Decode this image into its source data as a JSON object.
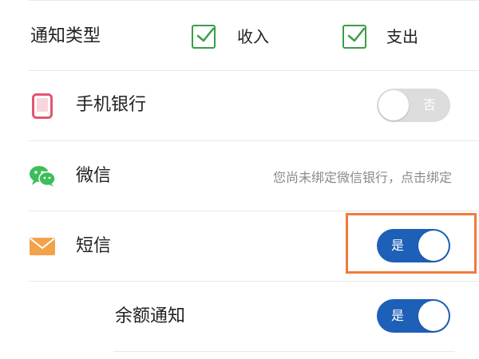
{
  "notify_type": {
    "label": "通知类型",
    "options": [
      {
        "label": "收入",
        "checked": true
      },
      {
        "label": "支出",
        "checked": true
      }
    ]
  },
  "mobile_banking": {
    "label": "手机银行",
    "icon": "phone-icon",
    "toggle_state": "off",
    "toggle_text": "否"
  },
  "wechat": {
    "label": "微信",
    "icon": "wechat-icon",
    "hint": "您尚未绑定微信银行，点击绑定"
  },
  "sms": {
    "label": "短信",
    "icon": "mail-icon",
    "toggle_state": "on",
    "toggle_text": "是"
  },
  "balance_notice": {
    "label": "余额通知",
    "toggle_state": "on",
    "toggle_text": "是"
  },
  "colors": {
    "toggle_on": "#1e5fb7",
    "toggle_off": "#dcdcdc",
    "check_green": "#3d9c47",
    "highlight": "#f07b3d"
  }
}
